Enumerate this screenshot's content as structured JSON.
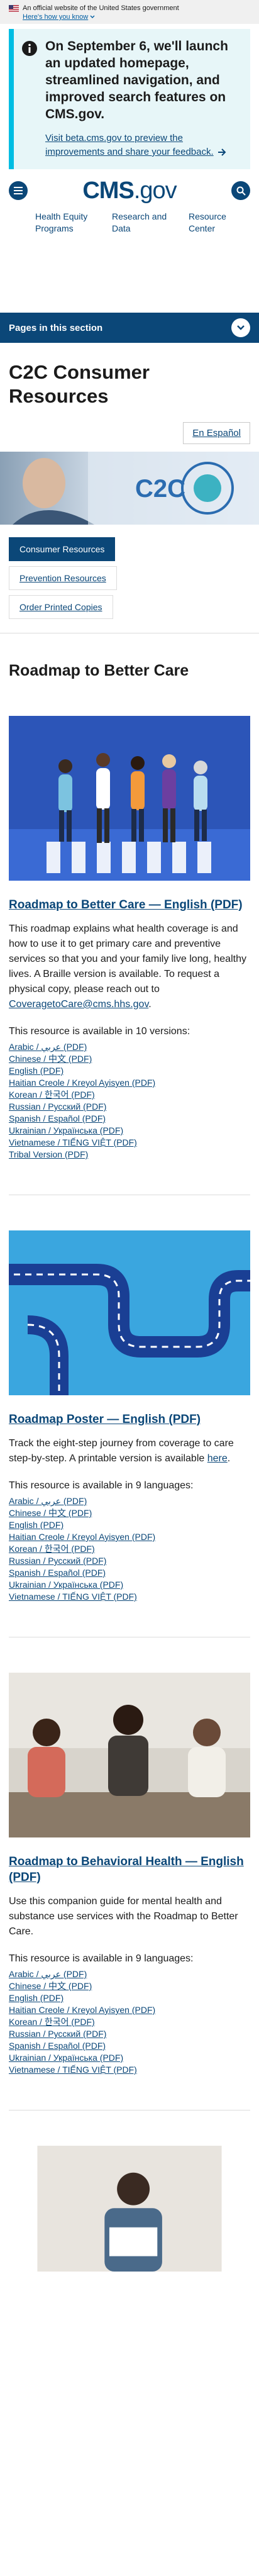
{
  "gov_banner": {
    "text": "An official website of the United States government",
    "how_know": "Here's how you know"
  },
  "alert": {
    "title": "On September 6, we'll launch an updated homepage, streamlined navigation, and improved search features on CMS.gov.",
    "link": "Visit beta.cms.gov to preview the improvements and share your feedback."
  },
  "header": {
    "logo_main": "CMS",
    "logo_suffix": ".gov"
  },
  "quick_nav": [
    "Health Equity Programs",
    "Research and Data",
    "Resource Center"
  ],
  "pages_bar": {
    "label": "Pages in this section"
  },
  "page_title": "C2C Consumer Resources",
  "lang_button": "En Español",
  "subnav": [
    "Consumer Resources",
    "Prevention Resources",
    "Order Printed Copies"
  ],
  "section_title": "Roadmap to Better Care",
  "cards": [
    {
      "title": "Roadmap to Better Care — English (PDF)",
      "desc": "This roadmap explains what health coverage is and how to use it to get primary care and preventive services so that you and your family live long, healthy lives. A Braille version is available. To request a physical copy, please reach out to ",
      "email": "CoveragetoCare@cms.hhs.gov",
      "desc_end": ".",
      "versions": "This resource is available in 10 versions:",
      "links": [
        "Arabic / عربي (PDF)",
        "Chinese / 中文 (PDF)",
        "English (PDF)",
        "Haitian Creole / Kreyol Ayisyen (PDF)",
        "Korean / 한국어 (PDF)",
        "Russian / Русский (PDF)",
        "Spanish / Español (PDF)",
        "Ukrainian / Українська (PDF)",
        "Vietnamese / TIẾNG VIỆT (PDF)",
        "Tribal Version (PDF)"
      ]
    },
    {
      "title": "Roadmap Poster — English (PDF)",
      "desc": "Track the eight-step journey from coverage to care step-by-step. A printable version is available ",
      "here": "here",
      "desc_end": ".",
      "versions": "This resource is available in 9 languages:",
      "links": [
        "Arabic / عربي (PDF)",
        "Chinese / 中文 (PDF)",
        "English (PDF)",
        "Haitian Creole / Kreyol Ayisyen (PDF)",
        "Korean / 한국어 (PDF)",
        "Russian / Русский (PDF)",
        "Spanish / Español (PDF)",
        "Ukrainian / Українська (PDF)",
        "Vietnamese / TIẾNG VIỆT (PDF)"
      ]
    },
    {
      "title": "Roadmap to Behavioral Health — English (PDF)",
      "desc": "Use this companion guide for mental health and substance use services with the Roadmap to Better Care.",
      "versions": "This resource is available in 9 languages:",
      "links": [
        "Arabic / عربي (PDF)",
        "Chinese / 中文 (PDF)",
        "English (PDF)",
        "Haitian Creole / Kreyol Ayisyen (PDF)",
        "Korean / 한국어 (PDF)",
        "Russian / Русский (PDF)",
        "Spanish / Español (PDF)",
        "Ukrainian / Українська (PDF)",
        "Vietnamese / TIẾNG VIỆT (PDF)"
      ]
    }
  ],
  "colors": {
    "brand": "#0b4778",
    "alert_border": "#00bde3",
    "alert_bg": "#e7f6f8"
  }
}
